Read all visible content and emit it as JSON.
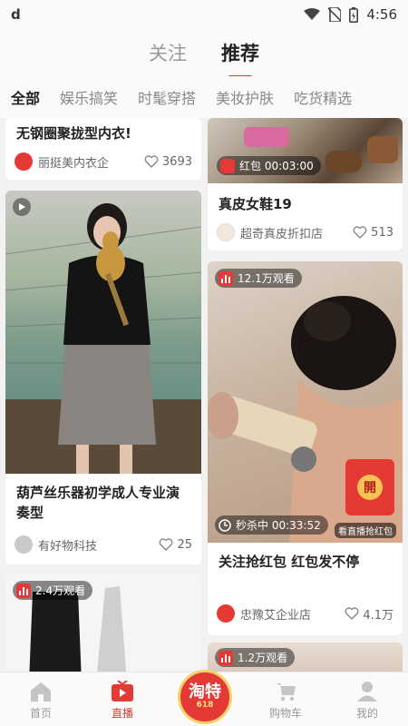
{
  "statusbar": {
    "app_glyph": "d",
    "time": "4:56"
  },
  "topnav": {
    "tabs": [
      {
        "label": "关注"
      },
      {
        "label": "推荐"
      }
    ],
    "active": "推荐"
  },
  "categories": [
    "全部",
    "娱乐搞笑",
    "时髦穿搭",
    "美妆护肤",
    "吃货精选"
  ],
  "cards": {
    "c1": {
      "title": "无钢圈聚拢型内衣!",
      "shop": "丽挺美内衣企",
      "likes": "3693"
    },
    "c2": {
      "badge": "红包 00:03:00",
      "title": "真皮女鞋19",
      "shop": "超奇真皮折扣店",
      "likes": "513"
    },
    "c3": {
      "title": "葫芦丝乐器初学成人专业演奏型",
      "shop": "有好物科技",
      "likes": "25"
    },
    "c4": {
      "badge": "12.1万观看",
      "flash": "秒杀中 00:33:52",
      "tip": "看直播抢红包",
      "redpacket": "開",
      "title": "关注抢红包 红包发不停",
      "shop": "忠豫艾企业店",
      "likes": "4.1万"
    },
    "c5": {
      "badge": "2.4万观看"
    },
    "c6": {
      "badge": "1.2万观看"
    }
  },
  "bottombar": {
    "items": [
      {
        "label": "首页",
        "icon": "home-icon"
      },
      {
        "label": "直播",
        "icon": "live-tv-icon"
      },
      {
        "label": "购物车",
        "icon": "cart-icon"
      },
      {
        "label": "我的",
        "icon": "profile-icon"
      }
    ],
    "center_logo": {
      "text": "淘特",
      "sub": "618"
    }
  },
  "colors": {
    "accent": "#e53935",
    "background": "#f2f2f2"
  }
}
